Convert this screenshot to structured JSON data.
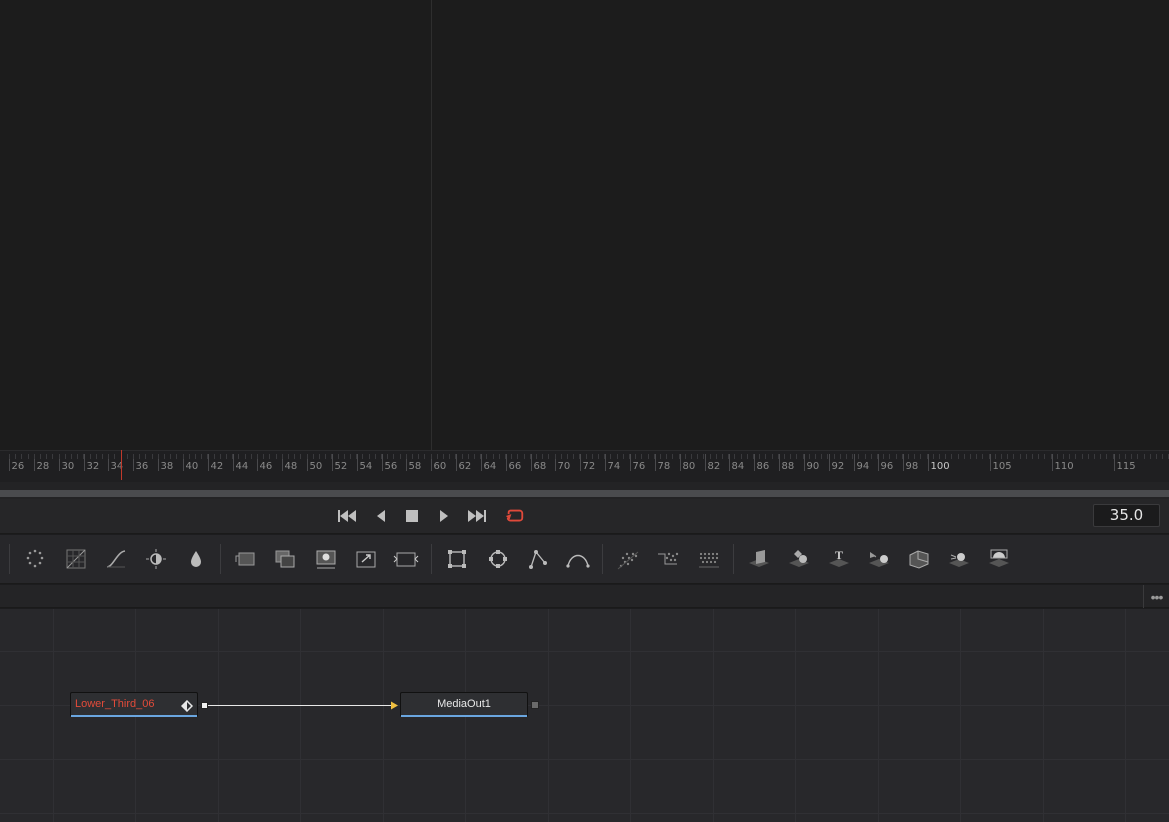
{
  "timeline": {
    "ruler_labels": [
      "26",
      "28",
      "30",
      "32",
      "34",
      "36",
      "38",
      "40",
      "42",
      "44",
      "46",
      "48",
      "50",
      "52",
      "54",
      "56",
      "58",
      "60",
      "62",
      "64",
      "66",
      "68",
      "70",
      "72",
      "74",
      "76",
      "78",
      "80",
      "82",
      "84",
      "86",
      "88",
      "90",
      "92",
      "94",
      "96",
      "98",
      "100",
      "105",
      "110",
      "115"
    ],
    "current_frame": 34
  },
  "transport": {
    "buttons": [
      "go-to-start-icon",
      "play-reverse-icon",
      "stop-icon",
      "play-forward-icon",
      "go-to-end-icon",
      "loop-icon"
    ],
    "current_time": "35.0",
    "loop_color": "#e0493a"
  },
  "toolbar": {
    "tools": [
      "particles-icon",
      "color-corrector-icon",
      "curves-icon",
      "brightness-contrast-icon",
      "blur-icon",
      "background-icon",
      "merge-icon",
      "matte-control-icon",
      "transform-icon",
      "resize-icon",
      "rectangle-mask-icon",
      "ellipse-mask-icon",
      "polygon-mask-icon",
      "bspline-mask-icon",
      "p-emitter-icon",
      "p-render-icon",
      "p-directional-icon",
      "shape-3d-icon",
      "merge-3d-icon",
      "text-3d-icon",
      "camera-3d-icon",
      "renderer-3d-icon",
      "light-3d-icon",
      "image-plane-3d-icon"
    ]
  },
  "nodegraph": {
    "more_label": "•••",
    "nodes": [
      {
        "name": "Lower_Third_06",
        "color": "#e34b3a"
      },
      {
        "name": "MediaOut1",
        "color": "#e8e8e8"
      }
    ],
    "connection_color": "#f0c040",
    "underline_color": "#6aa6e0"
  }
}
